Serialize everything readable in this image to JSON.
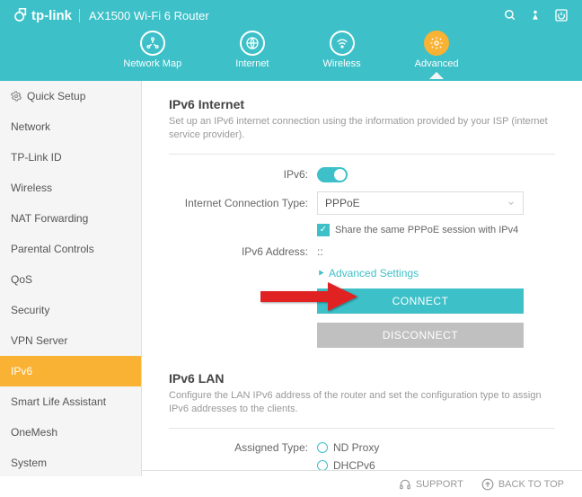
{
  "header": {
    "brand": "tp-link",
    "model": "AX1500 Wi-Fi 6 Router"
  },
  "nav": {
    "items": [
      {
        "label": "Network Map"
      },
      {
        "label": "Internet"
      },
      {
        "label": "Wireless"
      },
      {
        "label": "Advanced"
      }
    ]
  },
  "sidebar": {
    "items": [
      {
        "label": "Quick Setup"
      },
      {
        "label": "Network"
      },
      {
        "label": "TP-Link ID"
      },
      {
        "label": "Wireless"
      },
      {
        "label": "NAT Forwarding"
      },
      {
        "label": "Parental Controls"
      },
      {
        "label": "QoS"
      },
      {
        "label": "Security"
      },
      {
        "label": "VPN Server"
      },
      {
        "label": "IPv6"
      },
      {
        "label": "Smart Life Assistant"
      },
      {
        "label": "OneMesh"
      },
      {
        "label": "System"
      }
    ]
  },
  "ipv6internet": {
    "title": "IPv6 Internet",
    "desc": "Set up an IPv6 internet connection using the information provided by your ISP (internet service provider).",
    "ipv6_label": "IPv6:",
    "conn_type_label": "Internet Connection Type:",
    "conn_type_value": "PPPoE",
    "share_session": "Share the same PPPoE session with IPv4",
    "ipv6_addr_label": "IPv6 Address:",
    "ipv6_addr_value": "::",
    "adv_settings": "Advanced Settings",
    "connect": "CONNECT",
    "disconnect": "DISCONNECT"
  },
  "ipv6lan": {
    "title": "IPv6 LAN",
    "desc": "Configure the LAN IPv6 address of the router and set the configuration type to assign IPv6 addresses to the clients.",
    "assigned_type_label": "Assigned Type:",
    "option1": "ND Proxy",
    "option2": "DHCPv6"
  },
  "footer": {
    "support": "SUPPORT",
    "back_to_top": "BACK TO TOP"
  }
}
